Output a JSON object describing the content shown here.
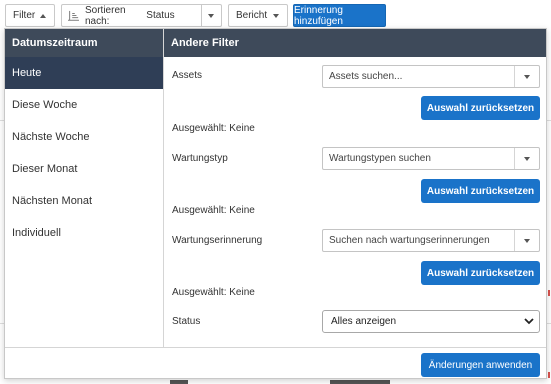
{
  "toolbar": {
    "filter_label": "Filter",
    "sort_label": "Sortieren nach:",
    "sort_value": "Status",
    "report_label": "Bericht",
    "add_reminder_label": "Erinnerung hinzufügen"
  },
  "date_panel": {
    "header": "Datumszeitraum",
    "items": [
      {
        "label": "Heute",
        "active": true
      },
      {
        "label": "Diese Woche",
        "active": false
      },
      {
        "label": "Nächste Woche",
        "active": false
      },
      {
        "label": "Dieser Monat",
        "active": false
      },
      {
        "label": "Nächsten Monat",
        "active": false
      },
      {
        "label": "Individuell",
        "active": false
      }
    ]
  },
  "other_filters": {
    "header": "Andere Filter",
    "assets": {
      "label": "Assets",
      "placeholder": "Assets suchen...",
      "reset_label": "Auswahl zurücksetzen",
      "selected_text": "Ausgewählt: Keine"
    },
    "maintenance_type": {
      "label": "Wartungstyp",
      "placeholder": "Wartungstypen suchen",
      "reset_label": "Auswahl zurücksetzen",
      "selected_text": "Ausgewählt: Keine"
    },
    "maintenance_reminder": {
      "label": "Wartungserinnerung",
      "placeholder": "Suchen nach wartungserinnerungen",
      "reset_label": "Auswahl zurücksetzen",
      "selected_text": "Ausgewählt: Keine"
    },
    "status": {
      "label": "Status",
      "value": "Alles anzeigen"
    }
  },
  "footer": {
    "apply_label": "Änderungen anwenden"
  },
  "colors": {
    "primary": "#1a73c9",
    "header_bg": "#3e4a5a",
    "active_item_bg": "#2f3e56"
  }
}
